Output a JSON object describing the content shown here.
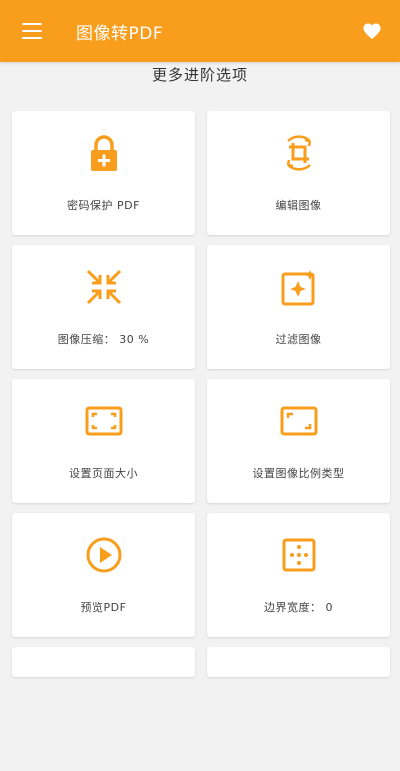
{
  "appbar": {
    "title": "图像转PDF",
    "menu_icon": "menu-icon",
    "favorite_icon": "heart-icon",
    "accent_color": "#f99d1c"
  },
  "section": {
    "title": "更多进阶选项"
  },
  "options": [
    {
      "label": "密码保护 PDF",
      "icon": "lock-plus-icon"
    },
    {
      "label": "编辑图像",
      "icon": "crop-rotate-icon"
    },
    {
      "label": "图像压缩： 30 %",
      "icon": "compress-icon"
    },
    {
      "label": "过滤图像",
      "icon": "image-filter-icon"
    },
    {
      "label": "设置页面大小",
      "icon": "page-size-icon"
    },
    {
      "label": "设置图像比例类型",
      "icon": "aspect-ratio-icon"
    },
    {
      "label": "预览PDF",
      "icon": "play-circle-icon"
    },
    {
      "label": "边界宽度： 0",
      "icon": "border-width-icon"
    }
  ]
}
